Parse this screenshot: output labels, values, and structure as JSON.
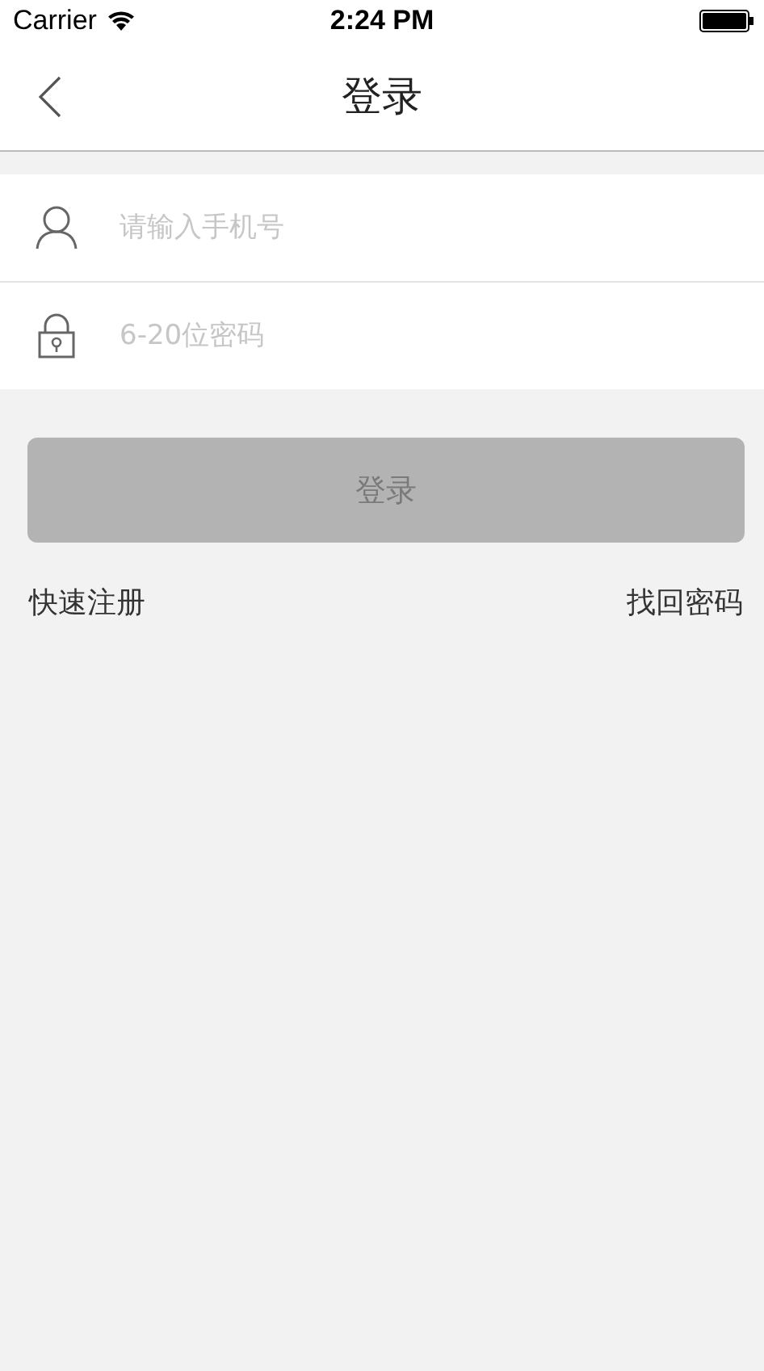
{
  "status_bar": {
    "carrier": "Carrier",
    "time": "2:24 PM"
  },
  "nav": {
    "title": "登录"
  },
  "fields": [
    {
      "kind": "user",
      "placeholder": "请输入手机号"
    },
    {
      "kind": "lock",
      "placeholder": "6-20位密码"
    }
  ],
  "login_button": {
    "label": "登录",
    "disabled": true
  },
  "links": [
    "快速注册",
    "找回密码"
  ]
}
